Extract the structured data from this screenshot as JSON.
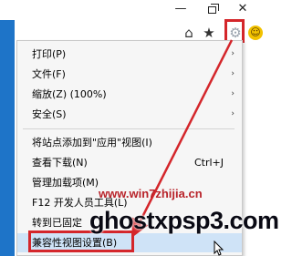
{
  "menu": {
    "items": [
      {
        "label": "打印(P)",
        "has_submenu": true
      },
      {
        "label": "文件(F)",
        "has_submenu": true
      },
      {
        "label": "缩放(Z) (100%)",
        "has_submenu": true
      },
      {
        "label": "安全(S)",
        "has_submenu": true
      },
      {
        "label": "将站点添加到\"应用\"视图(I)"
      },
      {
        "label": "查看下载(N)",
        "shortcut": "Ctrl+J"
      },
      {
        "label": "管理加载项(M)"
      },
      {
        "label": "F12 开发人员工具(L)"
      },
      {
        "label": "转到已固定"
      },
      {
        "label": "兼容性视图设置(B)"
      }
    ]
  },
  "toolbar": {
    "icons": [
      "home-icon",
      "star-icon",
      "gear-icon",
      "smiley-icon"
    ]
  },
  "watermark": {
    "line1": "www.win7zhijia.cn",
    "line2": "ghostxpsp3.com"
  },
  "colors": {
    "annotation_red": "#d4262b",
    "highlight": "#cfe3f7",
    "left_strip": "#1E74C8"
  }
}
